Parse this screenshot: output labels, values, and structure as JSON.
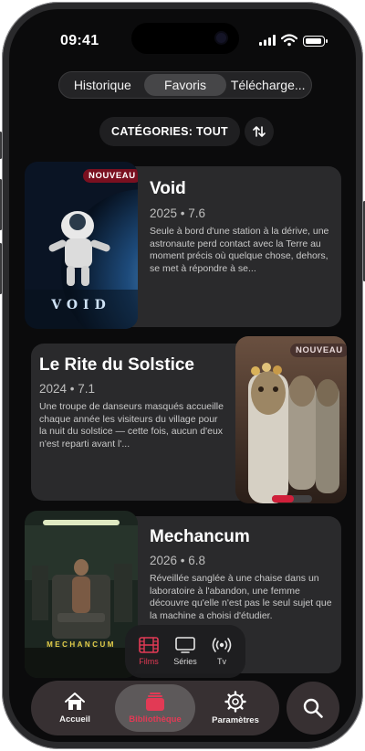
{
  "status": {
    "time": "09:41"
  },
  "segments": [
    {
      "label": "Historique"
    },
    {
      "label": "Favoris"
    },
    {
      "label": "Télécharge..."
    }
  ],
  "category": {
    "label": "CATÉGORIES: TOUT"
  },
  "movies": [
    {
      "title": "Void",
      "year": "2025",
      "rating": "7.6",
      "meta": "2025 • 7.6",
      "badge": "NOUVEAU",
      "poster_text": "VOID",
      "description": "Seule à bord d'une station à la dérive, une astronaute perd contact avec la Terre au moment précis où quelque chose, dehors, se met à répondre à se..."
    },
    {
      "title": "Le Rite du Solstice",
      "year": "2024",
      "rating": "7.1",
      "meta": "2024 • 7.1",
      "badge": "NOUVEAU",
      "progress": 0.55,
      "description": "Une troupe de danseurs masqués accueille chaque année les visiteurs du village pour la nuit du solstice — cette fois, aucun d'eux n'est reparti avant l'..."
    },
    {
      "title": "Mechancum",
      "year": "2026",
      "rating": "6.8",
      "meta": "2026 • 6.8",
      "poster_text": "MECHANCUM",
      "description": "Réveillée sanglée à une chaise dans un laboratoire à l'abandon, une femme découvre qu'elle n'est pas le seul sujet que la machine a choisi d'étudier."
    }
  ],
  "media_types": [
    {
      "label": "Films",
      "icon": "film-icon",
      "active": true
    },
    {
      "label": "Séries",
      "icon": "tv-icon",
      "active": false
    },
    {
      "label": "Tv",
      "icon": "broadcast-icon",
      "active": false
    }
  ],
  "tabs": [
    {
      "label": "Accueil",
      "icon": "home-icon"
    },
    {
      "label": "Bibliothèque",
      "icon": "library-icon",
      "active": true
    },
    {
      "label": "Paramètres",
      "icon": "gear-icon"
    }
  ],
  "colors": {
    "accent": "#e23a55",
    "card": "#2a2a2c",
    "background": "#0b0b0c"
  }
}
